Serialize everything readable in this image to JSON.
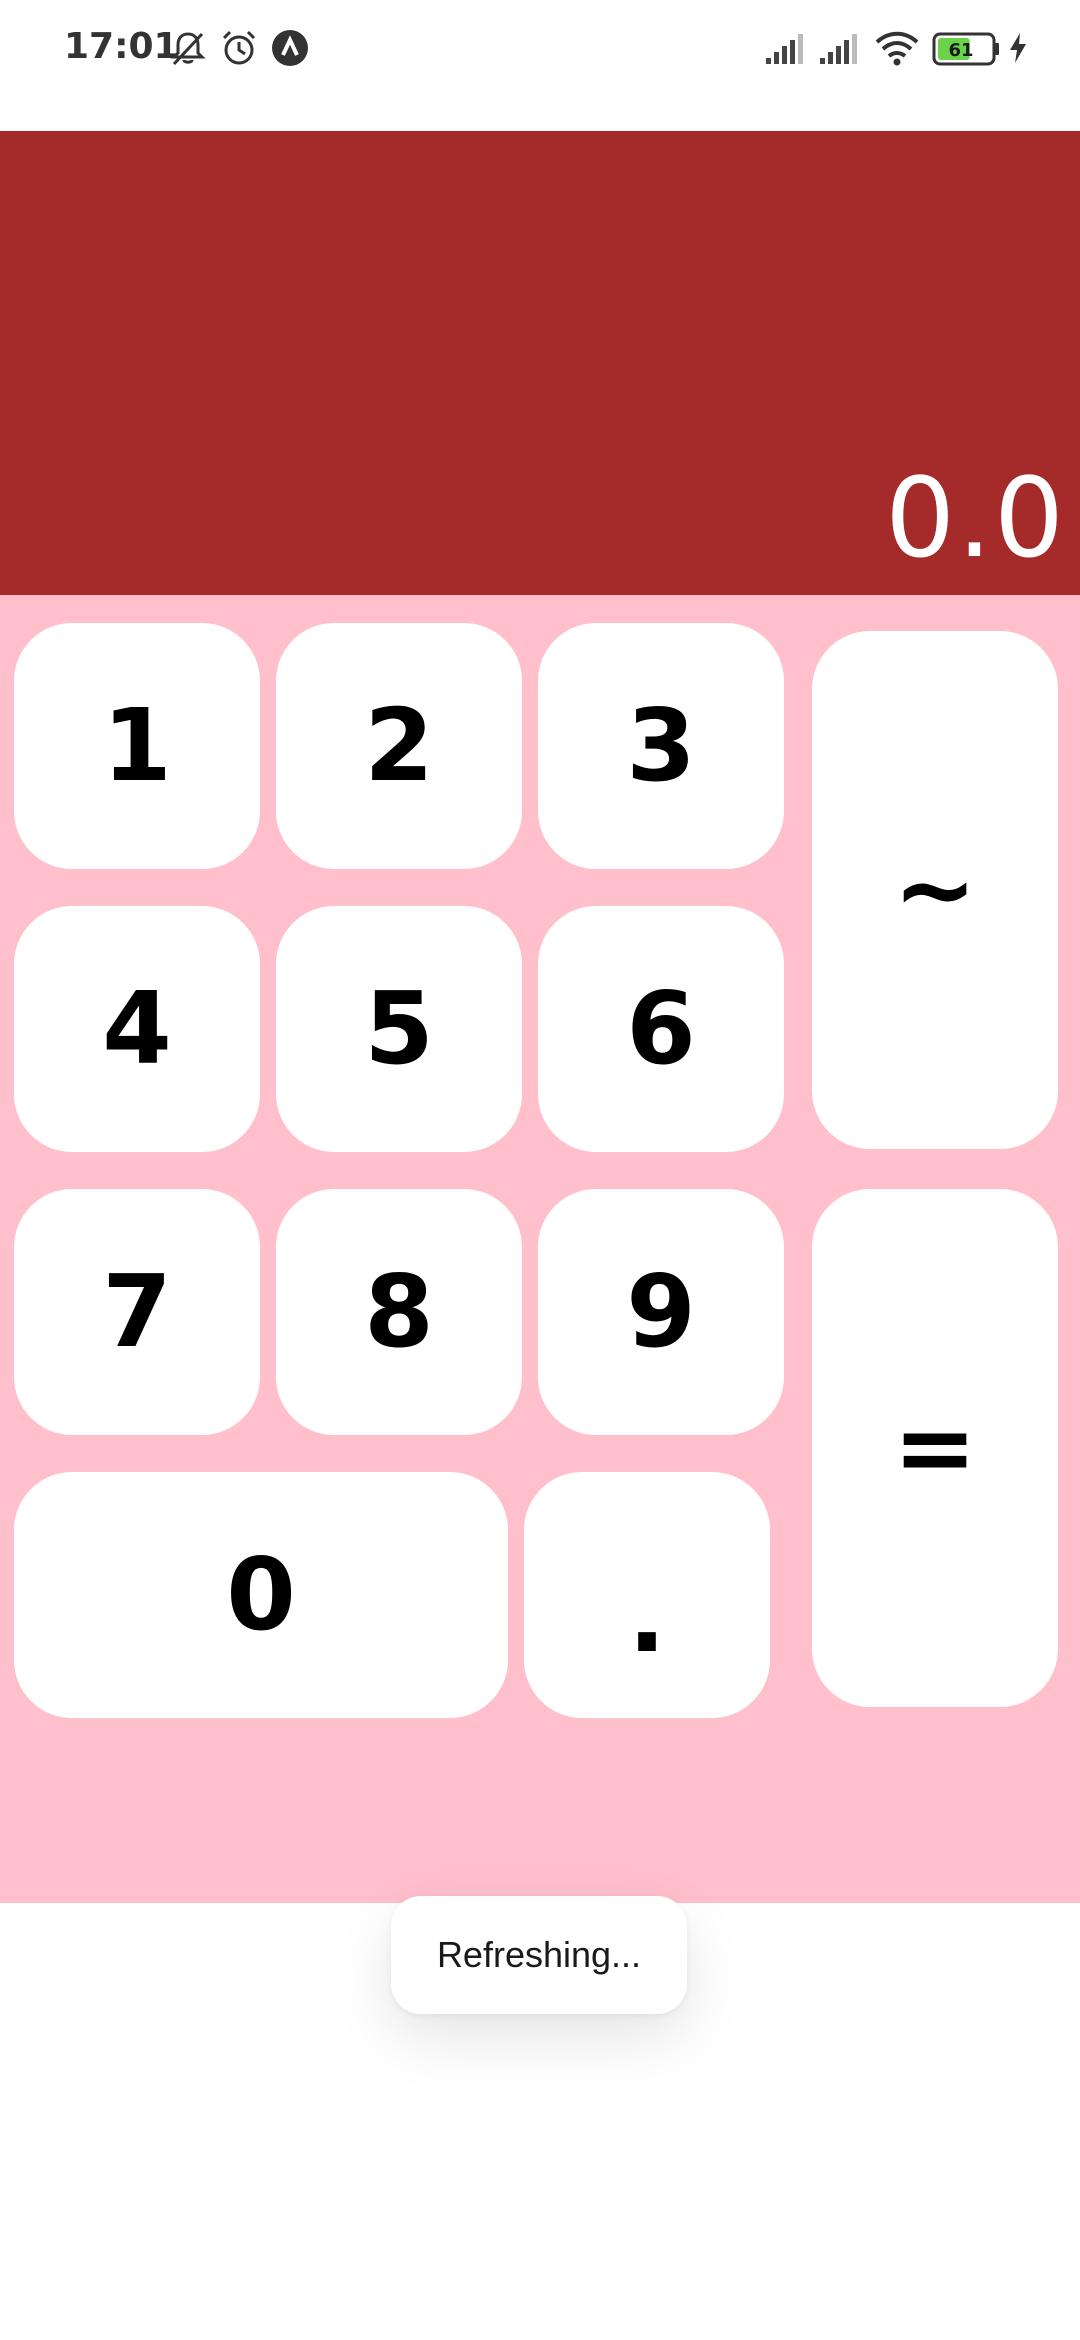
{
  "status_bar": {
    "time": "17:01",
    "icons": [
      "bell-muted-icon",
      "alarm-icon",
      "app-notification-icon",
      "signal-icon",
      "signal-icon",
      "wifi-icon",
      "battery-icon",
      "charging-icon"
    ],
    "battery_level": "61",
    "battery_color": "#6bd34a"
  },
  "display": {
    "value": "0.0",
    "background": "#a52a2a"
  },
  "keypad": {
    "background": "#ffc0cb",
    "keys": {
      "k1": "1",
      "k2": "2",
      "k3": "3",
      "k4": "4",
      "k5": "5",
      "k6": "6",
      "k7": "7",
      "k8": "8",
      "k9": "9",
      "k0": "0",
      "dot": ".",
      "tilde": "~",
      "equals": "="
    }
  },
  "toast": {
    "text": "Refreshing..."
  }
}
